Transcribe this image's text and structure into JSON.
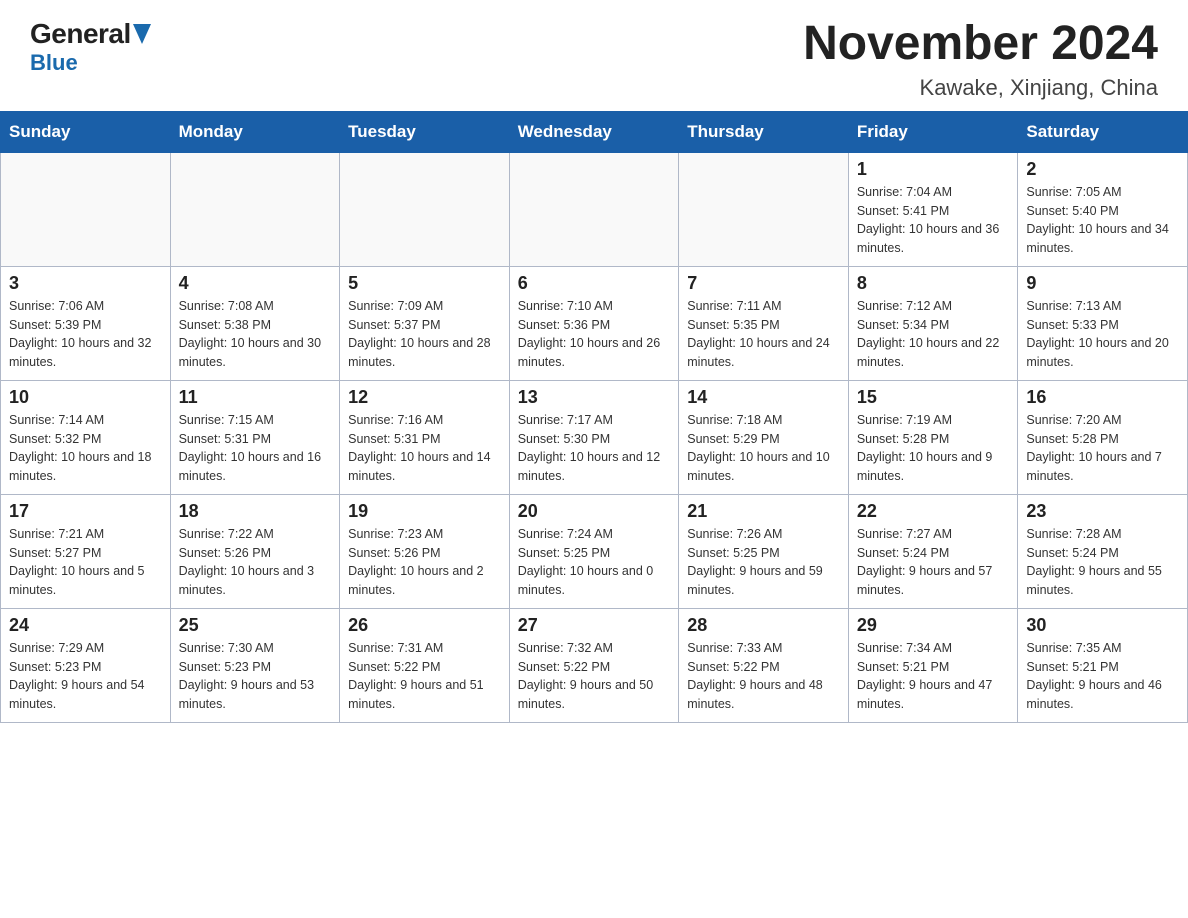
{
  "header": {
    "logo_general": "General",
    "logo_blue": "Blue",
    "month_title": "November 2024",
    "location": "Kawake, Xinjiang, China"
  },
  "weekdays": [
    "Sunday",
    "Monday",
    "Tuesday",
    "Wednesday",
    "Thursday",
    "Friday",
    "Saturday"
  ],
  "weeks": [
    [
      {
        "day": "",
        "info": ""
      },
      {
        "day": "",
        "info": ""
      },
      {
        "day": "",
        "info": ""
      },
      {
        "day": "",
        "info": ""
      },
      {
        "day": "",
        "info": ""
      },
      {
        "day": "1",
        "info": "Sunrise: 7:04 AM\nSunset: 5:41 PM\nDaylight: 10 hours and 36 minutes."
      },
      {
        "day": "2",
        "info": "Sunrise: 7:05 AM\nSunset: 5:40 PM\nDaylight: 10 hours and 34 minutes."
      }
    ],
    [
      {
        "day": "3",
        "info": "Sunrise: 7:06 AM\nSunset: 5:39 PM\nDaylight: 10 hours and 32 minutes."
      },
      {
        "day": "4",
        "info": "Sunrise: 7:08 AM\nSunset: 5:38 PM\nDaylight: 10 hours and 30 minutes."
      },
      {
        "day": "5",
        "info": "Sunrise: 7:09 AM\nSunset: 5:37 PM\nDaylight: 10 hours and 28 minutes."
      },
      {
        "day": "6",
        "info": "Sunrise: 7:10 AM\nSunset: 5:36 PM\nDaylight: 10 hours and 26 minutes."
      },
      {
        "day": "7",
        "info": "Sunrise: 7:11 AM\nSunset: 5:35 PM\nDaylight: 10 hours and 24 minutes."
      },
      {
        "day": "8",
        "info": "Sunrise: 7:12 AM\nSunset: 5:34 PM\nDaylight: 10 hours and 22 minutes."
      },
      {
        "day": "9",
        "info": "Sunrise: 7:13 AM\nSunset: 5:33 PM\nDaylight: 10 hours and 20 minutes."
      }
    ],
    [
      {
        "day": "10",
        "info": "Sunrise: 7:14 AM\nSunset: 5:32 PM\nDaylight: 10 hours and 18 minutes."
      },
      {
        "day": "11",
        "info": "Sunrise: 7:15 AM\nSunset: 5:31 PM\nDaylight: 10 hours and 16 minutes."
      },
      {
        "day": "12",
        "info": "Sunrise: 7:16 AM\nSunset: 5:31 PM\nDaylight: 10 hours and 14 minutes."
      },
      {
        "day": "13",
        "info": "Sunrise: 7:17 AM\nSunset: 5:30 PM\nDaylight: 10 hours and 12 minutes."
      },
      {
        "day": "14",
        "info": "Sunrise: 7:18 AM\nSunset: 5:29 PM\nDaylight: 10 hours and 10 minutes."
      },
      {
        "day": "15",
        "info": "Sunrise: 7:19 AM\nSunset: 5:28 PM\nDaylight: 10 hours and 9 minutes."
      },
      {
        "day": "16",
        "info": "Sunrise: 7:20 AM\nSunset: 5:28 PM\nDaylight: 10 hours and 7 minutes."
      }
    ],
    [
      {
        "day": "17",
        "info": "Sunrise: 7:21 AM\nSunset: 5:27 PM\nDaylight: 10 hours and 5 minutes."
      },
      {
        "day": "18",
        "info": "Sunrise: 7:22 AM\nSunset: 5:26 PM\nDaylight: 10 hours and 3 minutes."
      },
      {
        "day": "19",
        "info": "Sunrise: 7:23 AM\nSunset: 5:26 PM\nDaylight: 10 hours and 2 minutes."
      },
      {
        "day": "20",
        "info": "Sunrise: 7:24 AM\nSunset: 5:25 PM\nDaylight: 10 hours and 0 minutes."
      },
      {
        "day": "21",
        "info": "Sunrise: 7:26 AM\nSunset: 5:25 PM\nDaylight: 9 hours and 59 minutes."
      },
      {
        "day": "22",
        "info": "Sunrise: 7:27 AM\nSunset: 5:24 PM\nDaylight: 9 hours and 57 minutes."
      },
      {
        "day": "23",
        "info": "Sunrise: 7:28 AM\nSunset: 5:24 PM\nDaylight: 9 hours and 55 minutes."
      }
    ],
    [
      {
        "day": "24",
        "info": "Sunrise: 7:29 AM\nSunset: 5:23 PM\nDaylight: 9 hours and 54 minutes."
      },
      {
        "day": "25",
        "info": "Sunrise: 7:30 AM\nSunset: 5:23 PM\nDaylight: 9 hours and 53 minutes."
      },
      {
        "day": "26",
        "info": "Sunrise: 7:31 AM\nSunset: 5:22 PM\nDaylight: 9 hours and 51 minutes."
      },
      {
        "day": "27",
        "info": "Sunrise: 7:32 AM\nSunset: 5:22 PM\nDaylight: 9 hours and 50 minutes."
      },
      {
        "day": "28",
        "info": "Sunrise: 7:33 AM\nSunset: 5:22 PM\nDaylight: 9 hours and 48 minutes."
      },
      {
        "day": "29",
        "info": "Sunrise: 7:34 AM\nSunset: 5:21 PM\nDaylight: 9 hours and 47 minutes."
      },
      {
        "day": "30",
        "info": "Sunrise: 7:35 AM\nSunset: 5:21 PM\nDaylight: 9 hours and 46 minutes."
      }
    ]
  ]
}
